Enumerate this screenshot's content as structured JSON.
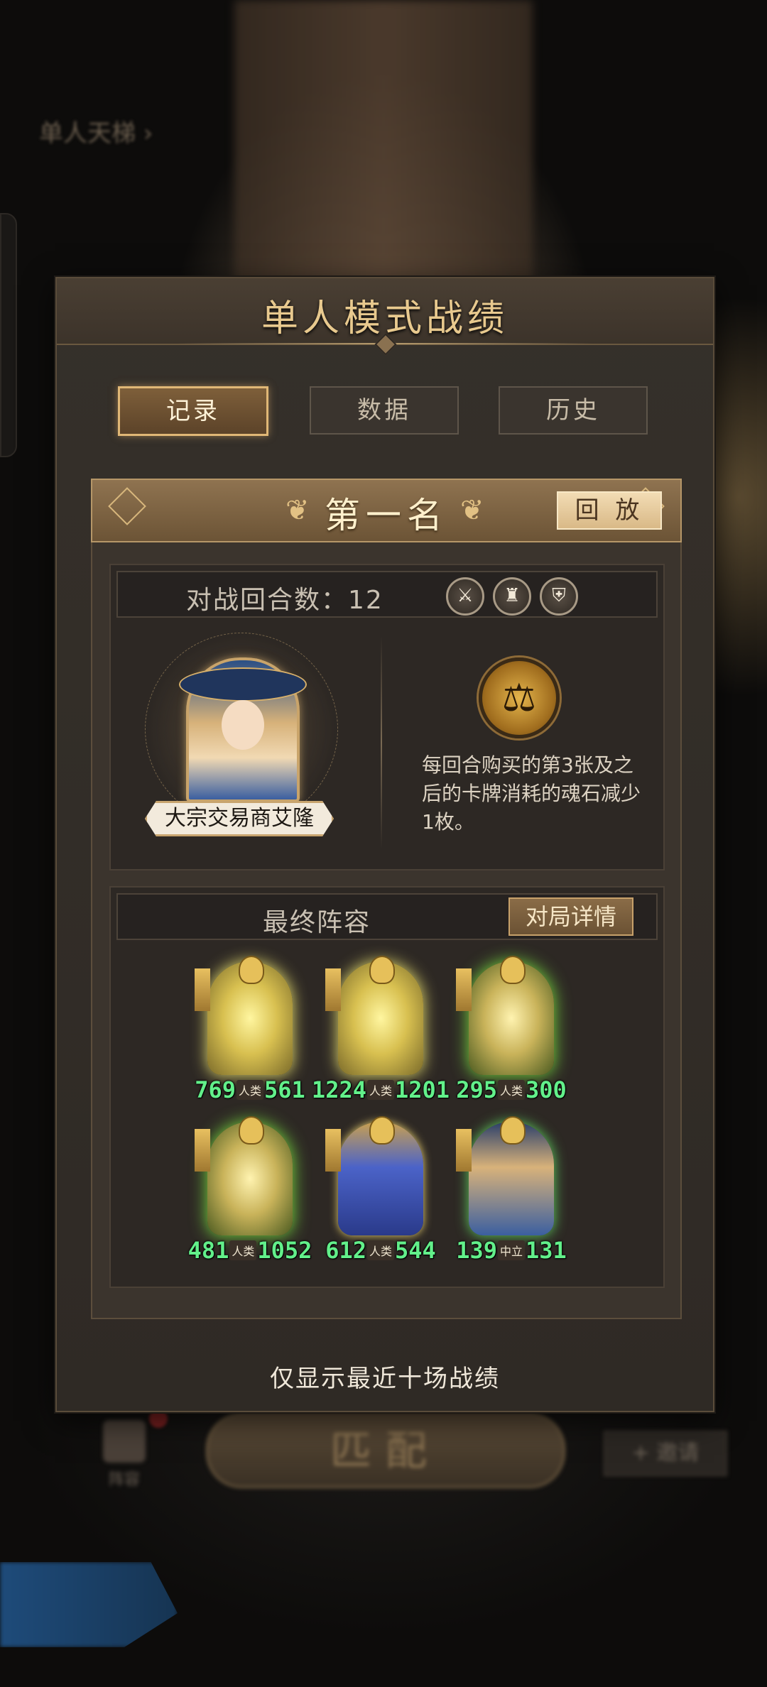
{
  "background": {
    "left_label": "单人天梯 ›",
    "match_button": "匹配",
    "left_icon_label": "阵容",
    "right_button": "+ 邀请"
  },
  "modal": {
    "title": "单人模式战绩",
    "tabs": [
      {
        "label": "记录",
        "active": true
      },
      {
        "label": "数据",
        "active": false
      },
      {
        "label": "历史",
        "active": false
      }
    ],
    "record": {
      "rank": "第一名",
      "replay_label": "回 放",
      "rounds_label": "对战回合数：12",
      "round_icons": [
        "sword-icon",
        "armor-icon",
        "shield-icon"
      ],
      "hero_name": "大宗交易商艾隆",
      "skill_icon": "balance-scale-icon",
      "skill_description": "每回合购买的第3张及之后的卡牌消耗的魂石减少1枚。",
      "lineup_title": "最终阵容",
      "detail_button": "对局详情",
      "units": [
        {
          "atk": "769",
          "race": "人类",
          "hp": "561"
        },
        {
          "atk": "1224",
          "race": "人类",
          "hp": "1201"
        },
        {
          "atk": "295",
          "race": "人类",
          "hp": "300"
        },
        {
          "atk": "481",
          "race": "人类",
          "hp": "1052"
        },
        {
          "atk": "612",
          "race": "人类",
          "hp": "544"
        },
        {
          "atk": "139",
          "race": "中立",
          "hp": "131"
        }
      ]
    },
    "footer_note": "仅显示最近十场战绩"
  },
  "colors": {
    "accent_gold": "#e8c98e",
    "stat_green": "#62f08a",
    "panel_bg": "#35302a"
  }
}
